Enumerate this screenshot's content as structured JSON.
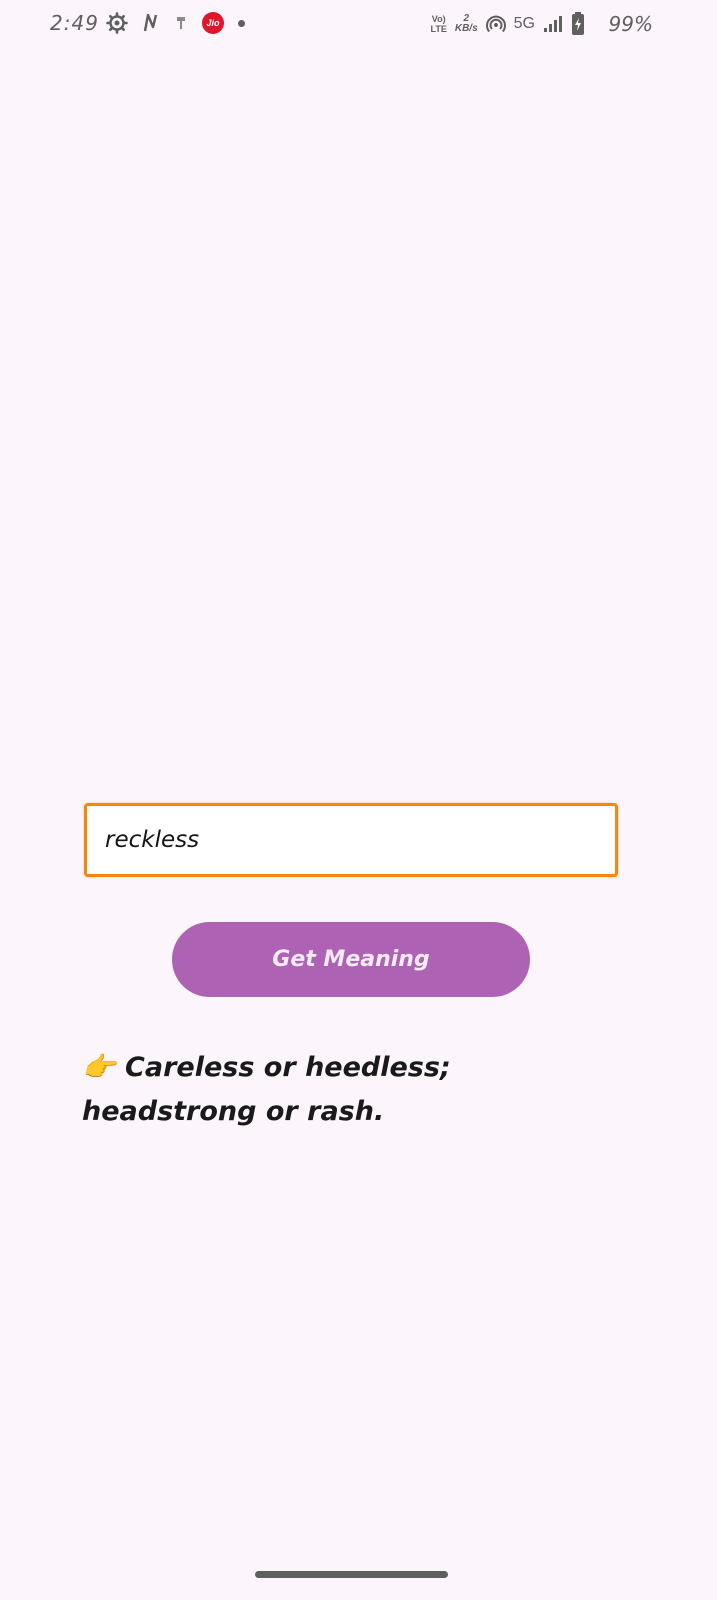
{
  "status_bar": {
    "time": "2:49",
    "carrier_badge": "Jio",
    "volte_top": "Vo)",
    "volte_bottom": "LTE",
    "data_rate_value": "2",
    "data_rate_unit": "KB/s",
    "network_type": "5G",
    "battery_percent": "99%",
    "icons": [
      "settings-gear-icon",
      "n-icon",
      "download-icon",
      "jio-icon",
      "dot-icon",
      "volte-icon",
      "hotspot-icon",
      "signal-icon",
      "battery-charging-icon"
    ]
  },
  "input": {
    "value": "reckless",
    "border_color": "#f7860f"
  },
  "button": {
    "label": "Get Meaning",
    "color": "#ad62b4"
  },
  "result": {
    "pointer": "👉",
    "text": "Careless or heedless; headstrong or rash."
  },
  "colors": {
    "background": "#fcf5fc"
  }
}
